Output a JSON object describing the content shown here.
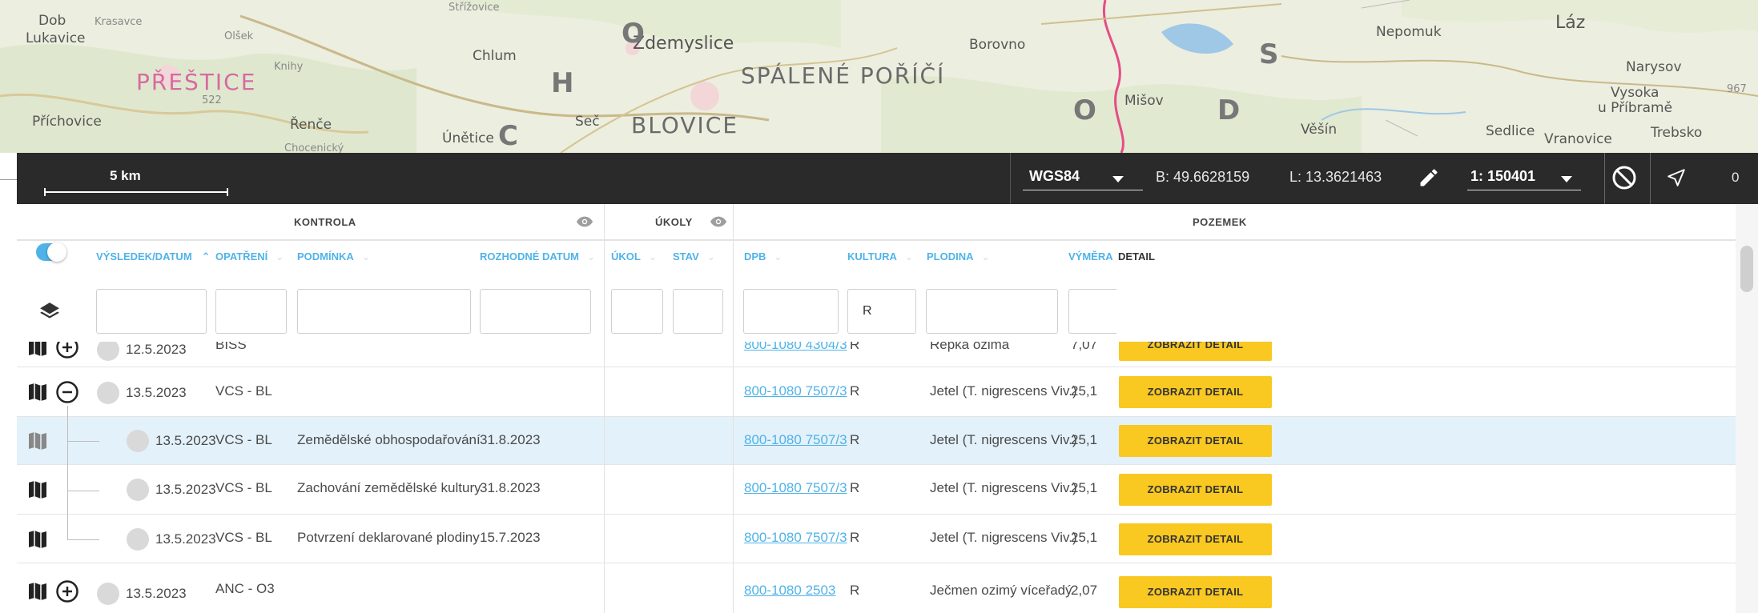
{
  "map": {
    "labels": {
      "dobrev": "Dob",
      "lukavice": "Lukavice",
      "krasavce": "Krasavce",
      "olsek": "Olšek",
      "chlum": "Chlum",
      "zdemyslice": "Zdemyslice",
      "borovno": "Borovno",
      "nepomuk": "Nepomuk",
      "laz": "Láz",
      "prestice": "PŘEŠTICE",
      "knihy": "Knihy",
      "spalene": "SPÁLENÉ POŘÍČÍ",
      "misov": "Mišov",
      "narysov": "Narysov",
      "vysoka": "Vysoka",
      "upribrame": "u Příbramě",
      "sedlice": "Sedlice",
      "vranovice": "Vranovice",
      "trebsko": "Trebsko",
      "prichovice": "Příchovice",
      "renec": "Řenče",
      "unetice": "Únětice",
      "sec": "Seč",
      "blovice": "BLOVICE",
      "vesin": "Věšín",
      "letter_h": "H",
      "letter_o": "O",
      "letter_c": "C",
      "letter_s": "S",
      "letter_d": "D",
      "letter_o2": "O",
      "num_522": "522",
      "num_967": "967",
      "strizovice": "Střížovice",
      "chocenicky": "Chocenický"
    }
  },
  "toolbar": {
    "scale_label": "5 km",
    "crs": "WGS84",
    "coord_b": "B: 49.6628159",
    "coord_l": "L: 13.3621463",
    "scale": "1: 150401",
    "nav_count": "0"
  },
  "table": {
    "groups": {
      "kontrola": "KONTROLA",
      "ukoly": "ÚKOLY",
      "pozemek": "POZEMEK"
    },
    "columns": {
      "vysledek": "VÝSLEDEK/DATUM",
      "opatreni": "OPATŘENÍ",
      "podminka": "PODMÍNKA",
      "rozhodne": "ROZHODNÉ DATUM",
      "ukol": "ÚKOL",
      "stav": "STAV",
      "dpb": "DPB",
      "kultura": "KULTURA",
      "plodina": "PLODINA",
      "vymera": "VÝMĚRA",
      "detail": "DETAIL"
    },
    "filters": {
      "kultura": "R"
    },
    "detail_button": "ZOBRAZIT DETAIL",
    "rows": [
      {
        "date": "12.5.2023",
        "opatreni": "BISS",
        "podminka": "",
        "rozhodne": "",
        "dpb": "800-1080 4304/3",
        "kultura": "R",
        "plodina": "Řepka ozimá",
        "vymera": "7,07"
      },
      {
        "date": "13.5.2023",
        "opatreni": "VCS - BL",
        "podminka": "",
        "rozhodne": "",
        "dpb": "800-1080 7507/3",
        "kultura": "R",
        "plodina": "Jetel (T. nigrescens Viv.)",
        "vymera": "25,1"
      },
      {
        "date": "13.5.2023",
        "opatreni": "VCS - BL",
        "podminka": "Zemědělské obhospodařování",
        "rozhodne": "31.8.2023",
        "dpb": "800-1080 7507/3",
        "kultura": "R",
        "plodina": "Jetel (T. nigrescens Viv.)",
        "vymera": "25,1"
      },
      {
        "date": "13.5.2023",
        "opatreni": "VCS - BL",
        "podminka": "Zachování zemědělské kultury",
        "rozhodne": "31.8.2023",
        "dpb": "800-1080 7507/3",
        "kultura": "R",
        "plodina": "Jetel (T. nigrescens Viv.)",
        "vymera": "25,1"
      },
      {
        "date": "13.5.2023",
        "opatreni": "VCS - BL",
        "podminka": "Potvrzení deklarované plodiny",
        "rozhodne": "15.7.2023",
        "dpb": "800-1080 7507/3",
        "kultura": "R",
        "plodina": "Jetel (T. nigrescens Viv.)",
        "vymera": "25,1"
      },
      {
        "date": "13.5.2023",
        "opatreni": "ANC - O3",
        "podminka": "",
        "rozhodne": "",
        "dpb": "800-1080 2503",
        "kultura": "R",
        "plodina": "Ječmen ozimý víceřadý",
        "vymera": "2,07"
      }
    ]
  },
  "colors": {
    "accent": "#4fb3e8",
    "button": "#f9c821",
    "toolbar": "#2a2a2a",
    "highlight_row": "#e3f1fa"
  }
}
